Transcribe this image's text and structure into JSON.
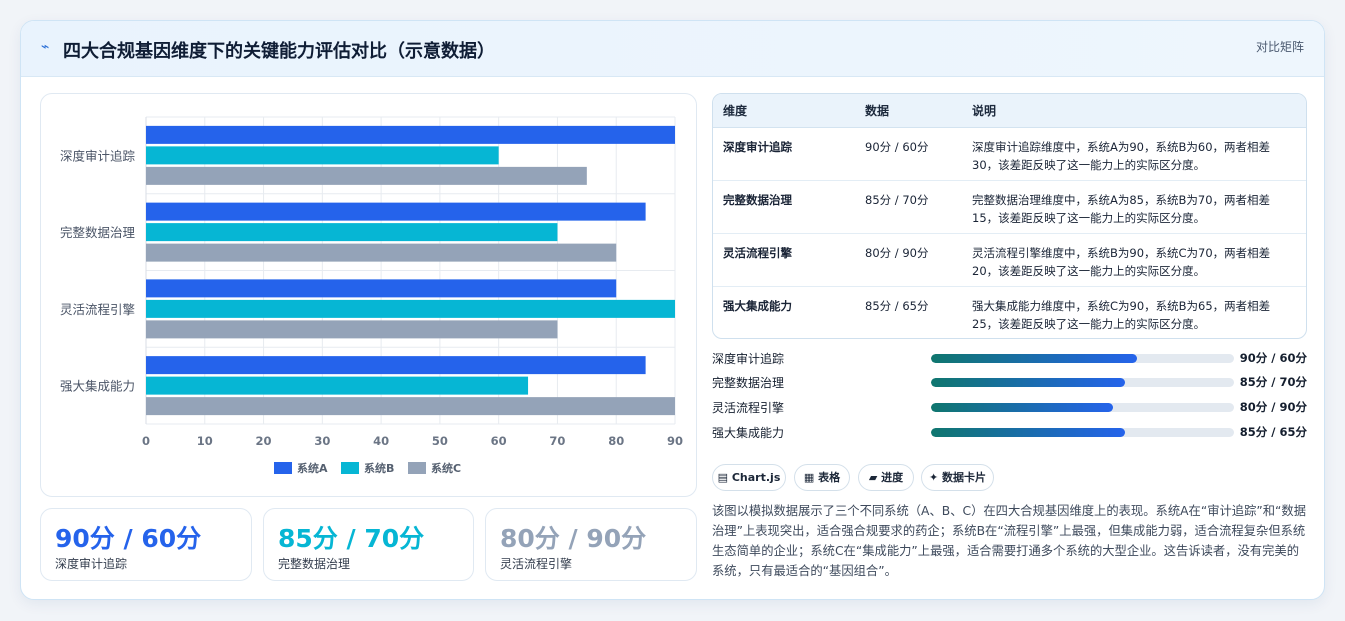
{
  "header": {
    "icon": "chart-icon",
    "title": "四大合规基因维度下的关键能力评估对比（示意数据）",
    "badge": "对比矩阵"
  },
  "chart_data": {
    "type": "bar",
    "orientation": "horizontal",
    "categories": [
      "深度审计追踪",
      "完整数据治理",
      "灵活流程引擎",
      "强大集成能力"
    ],
    "series": [
      {
        "name": "系统A",
        "values": [
          90,
          85,
          80,
          85
        ],
        "color": "#2563eb"
      },
      {
        "name": "系统B",
        "values": [
          60,
          70,
          90,
          65
        ],
        "color": "#06b6d4"
      },
      {
        "name": "系统C",
        "values": [
          75,
          80,
          70,
          90
        ],
        "color": "#94a3b8"
      }
    ],
    "xlim": [
      0,
      90
    ],
    "xticks": [
      0,
      10,
      20,
      30,
      40,
      50,
      60,
      70,
      80,
      90
    ],
    "grid": true,
    "legend": "bottom"
  },
  "stats": [
    {
      "value": "90分 / 60分",
      "label": "深度审计追踪",
      "color": "#2563eb"
    },
    {
      "value": "85分 / 70分",
      "label": "完整数据治理",
      "color": "#06b6d4"
    },
    {
      "value": "80分 / 90分",
      "label": "灵活流程引擎",
      "color": "#94a3b8"
    }
  ],
  "table": {
    "headers": [
      "维度",
      "数据",
      "说明"
    ],
    "rows": [
      {
        "dim": "深度审计追踪",
        "data": "90分 / 60分",
        "desc": "深度审计追踪维度中，系统A为90，系统B为60，两者相差30，该差距反映了这一能力上的实际区分度。"
      },
      {
        "dim": "完整数据治理",
        "data": "85分 / 70分",
        "desc": "完整数据治理维度中，系统A为85，系统B为70，两者相差15，该差距反映了这一能力上的实际区分度。"
      },
      {
        "dim": "灵活流程引擎",
        "data": "80分 / 90分",
        "desc": "灵活流程引擎维度中，系统B为90，系统C为70，两者相差20，该差距反映了这一能力上的实际区分度。"
      },
      {
        "dim": "强大集成能力",
        "data": "85分 / 65分",
        "desc": "强大集成能力维度中，系统C为90，系统B为65，两者相差25，该差距反映了这一能力上的实际区分度。"
      }
    ]
  },
  "progress": [
    {
      "label": "深度审计追踪",
      "value": "90分 / 60分",
      "fraction": 0.68
    },
    {
      "label": "完整数据治理",
      "value": "85分 / 70分",
      "fraction": 0.64
    },
    {
      "label": "灵活流程引擎",
      "value": "80分 / 90分",
      "fraction": 0.6
    },
    {
      "label": "强大集成能力",
      "value": "85分 / 65分",
      "fraction": 0.64
    }
  ],
  "tags": [
    {
      "icon": "chart-icon",
      "glyph": "▤",
      "label": "Chart.js"
    },
    {
      "icon": "table-icon",
      "glyph": "▦",
      "label": "表格"
    },
    {
      "icon": "progress-icon",
      "glyph": "▰",
      "label": "进度"
    },
    {
      "icon": "sparkle-icon",
      "glyph": "✦",
      "label": "数据卡片"
    }
  ],
  "note": "该图以模拟数据展示了三个不同系统（A、B、C）在四大合规基因维度上的表现。系统A在“审计追踪”和“数据治理”上表现突出，适合强合规要求的药企；系统B在“流程引擎”上最强，但集成能力弱，适合流程复杂但系统生态简单的企业；系统C在“集成能力”上最强，适合需要打通多个系统的大型企业。这告诉读者，没有完美的系统，只有最适合的“基因组合”。"
}
